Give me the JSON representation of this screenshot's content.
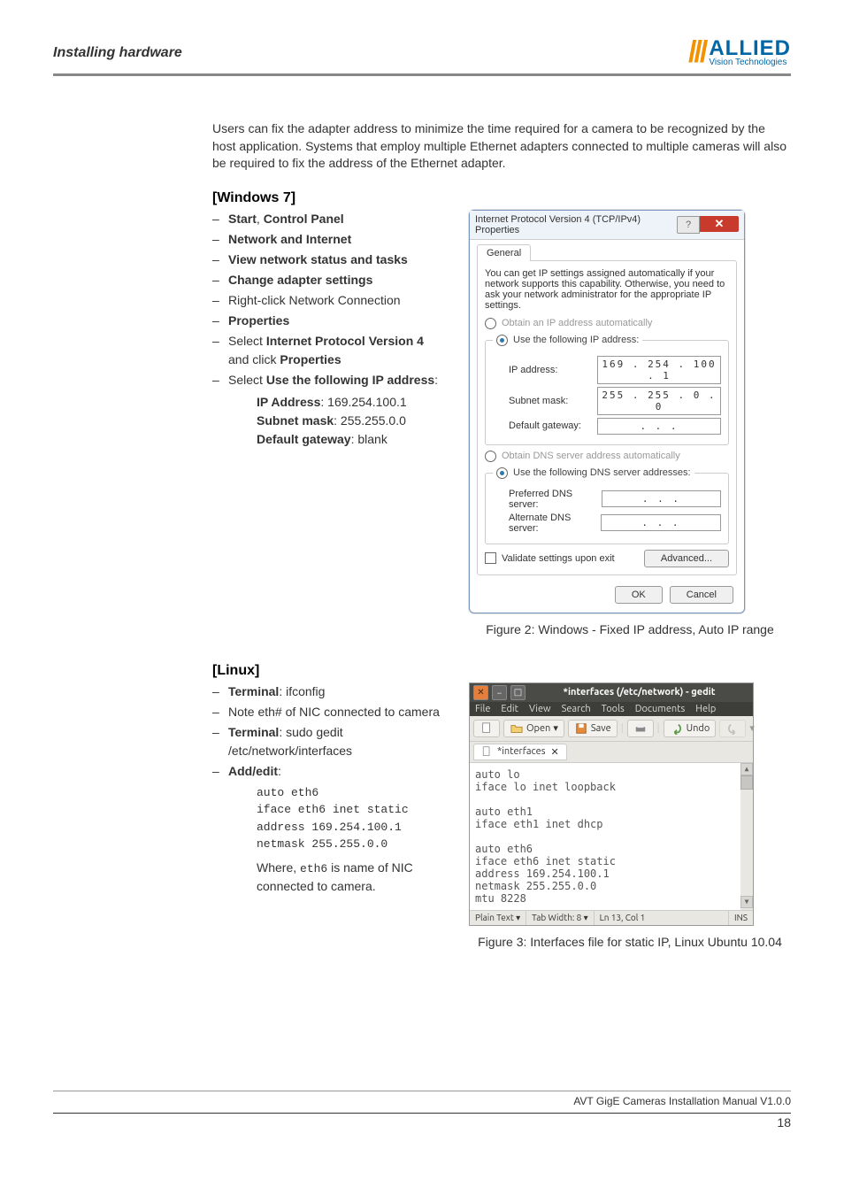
{
  "header": {
    "chapter": "Installing hardware"
  },
  "brand": {
    "slashes": "///",
    "main": "ALLIED",
    "sub": "Vision Technologies"
  },
  "intro": "Users can fix the adapter address to minimize the time required for a camera to be recognized by the host application. Systems that employ multiple Ethernet adapters connected to multiple cameras will also be required to fix the address of the Ethernet adapter.",
  "win": {
    "heading": "[Windows 7]",
    "steps": {
      "a": "Start",
      "a2": ", ",
      "a3": "Control Panel",
      "b": "Network and Internet",
      "c": "View network status and tasks",
      "d": "Change adapter settings",
      "e": "Right-click Network Connection",
      "f": "Properties",
      "g1": "Select ",
      "g2": "Internet Protocol Version 4",
      "g3": " and click ",
      "g4": "Properties",
      "h1": "Select ",
      "h2": "Use the following IP address",
      "h3": ":",
      "ip_label": "IP Address",
      "ip_val": ": 169.254.100.1",
      "sn_label": "Subnet mask",
      "sn_val": ": 255.255.0.0",
      "gw_label": "Default gateway",
      "gw_val": ": blank"
    },
    "dialog": {
      "title": "Internet Protocol Version 4 (TCP/IPv4) Properties",
      "tab": "General",
      "desc": "You can get IP settings assigned automatically if your network supports this capability. Otherwise, you need to ask your network administrator for the appropriate IP settings.",
      "r1": "Obtain an IP address automatically",
      "r2": "Use the following IP address:",
      "ip_lbl": "IP address:",
      "ip_v": "169 . 254 . 100 .   1",
      "sn_lbl": "Subnet mask:",
      "sn_v": "255 . 255 .   0 .   0",
      "gw_lbl": "Default gateway:",
      "gw_v": ".       .       .",
      "r3": "Obtain DNS server address automatically",
      "r4": "Use the following DNS server addresses:",
      "pd_lbl": "Preferred DNS server:",
      "pd_v": ".       .       .",
      "ad_lbl": "Alternate DNS server:",
      "ad_v": ".       .       .",
      "chk": "Validate settings upon exit",
      "adv": "Advanced...",
      "ok": "OK",
      "cancel": "Cancel"
    },
    "fig": "Figure 2: Windows - Fixed IP address, Auto IP range"
  },
  "linux": {
    "heading": "[Linux]",
    "steps": {
      "a1": "Terminal",
      "a2": ": ifconfig",
      "b": "Note eth# of NIC connected to camera",
      "c1": "Terminal",
      "c2": ": sudo gedit /etc/network/interfaces",
      "d": "Add/edit",
      "d2": ":",
      "code": "auto eth6\niface eth6 inet static\naddress 169.254.100.1\nnetmask 255.255.0.0",
      "note1": "Where, ",
      "note2": "eth6",
      "note3": " is name of NIC connected to camera."
    },
    "gedit": {
      "title": "*interfaces (/etc/network) - gedit",
      "menu": [
        "File",
        "Edit",
        "View",
        "Search",
        "Tools",
        "Documents",
        "Help"
      ],
      "tb": {
        "open": "Open",
        "save": "Save",
        "undo": "Undo"
      },
      "tab": "*interfaces",
      "body": "auto lo\niface lo inet loopback\n\nauto eth1\niface eth1 inet dhcp\n\nauto eth6\niface eth6 inet static\naddress 169.254.100.1\nnetmask 255.255.0.0\nmtu 8228",
      "status": {
        "a": "Plain Text",
        "b": "Tab Width: 8",
        "c": "Ln 13, Col 1",
        "d": "INS"
      }
    },
    "fig": "Figure 3: Interfaces file for static IP, Linux Ubuntu 10.04"
  },
  "footer": {
    "doc": "AVT GigE Cameras Installation Manual V1.0.0",
    "page": "18"
  }
}
